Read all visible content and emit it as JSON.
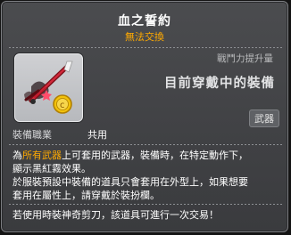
{
  "tooltip": {
    "title": "血之誓約",
    "subtitle": "無法交換",
    "power_label": "戰鬥力提升量",
    "power_text": "目前穿戴中的裝備",
    "type_badge": "武器",
    "job_label": "裝備職業",
    "job_value": "共用",
    "description": {
      "line1_prefix": "為",
      "line1_highlight": "所有武器",
      "line1_suffix": "上可套用的武器，裝備時，在特定動作下，",
      "line2": "顯示黑紅霧效果。",
      "line3": "於服裝預設中裝備的道具只會套用在外型上，如果想要",
      "line4": "套用在屬性上，請穿戴於裝扮欄。"
    },
    "footer": "若使用時裝神奇剪刀，該道具可進行一次交易！"
  },
  "colors": {
    "title": "#ffffff",
    "subtitle": "#ffaa00",
    "highlight": "#ffaa00",
    "background": "#444548"
  },
  "icons": {
    "item": "red-sword-with-gold-coin"
  }
}
